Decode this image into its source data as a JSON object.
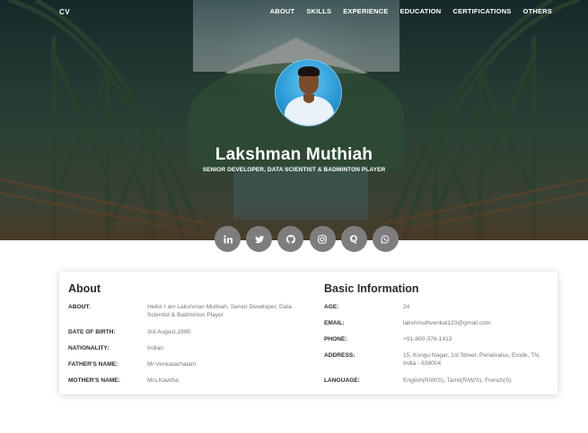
{
  "nav": {
    "brand": "CV",
    "links": [
      "ABOUT",
      "SKILLS",
      "EXPERIENCE",
      "EDUCATION",
      "CERTIFICATIONS",
      "OTHERS"
    ]
  },
  "hero": {
    "name": "Lakshman Muthiah",
    "tagline": "SENIOR DEVELOPER, DATA SCIENTIST & BADMINTON PLAYER"
  },
  "social": {
    "icons": [
      "linkedin-icon",
      "twitter-icon",
      "github-icon",
      "instagram-icon",
      "quora-icon",
      "whatsapp-icon"
    ]
  },
  "about": {
    "title": "About",
    "rows": [
      {
        "label": "ABOUT:",
        "value": "Hello! I am Lakshman Muthiah, Senior Developer, Data Scientist & Badminton Player"
      },
      {
        "label": "DATE OF BIRTH:",
        "value": "3rd August,1995"
      },
      {
        "label": "NATIONALITY:",
        "value": "Indian"
      },
      {
        "label": "FATHER'S NAME:",
        "value": "Mr.Venkatachalam"
      },
      {
        "label": "MOTHER'S NAME:",
        "value": "Mrs.Kavitha"
      }
    ]
  },
  "basic": {
    "title": "Basic Information",
    "rows": [
      {
        "label": "AGE:",
        "value": "24"
      },
      {
        "label": "EMAIL:",
        "value": "lakshmuthvenkat123@gmail.com"
      },
      {
        "label": "PHONE:",
        "value": "+91-890-376-1413"
      },
      {
        "label": "ADDRESS:",
        "value": "15, Kongu Nagar, 1st Street, Perialvalsu, Erode, TN, India - 638004"
      },
      {
        "label": "LANGUAGE:",
        "value": "English(R/W/S), Tamil(R/W/S), French(S)"
      }
    ]
  },
  "colors": {
    "social_bg": "#7d7d7d",
    "heading": "#2b2b2b",
    "value_text": "#777777"
  }
}
